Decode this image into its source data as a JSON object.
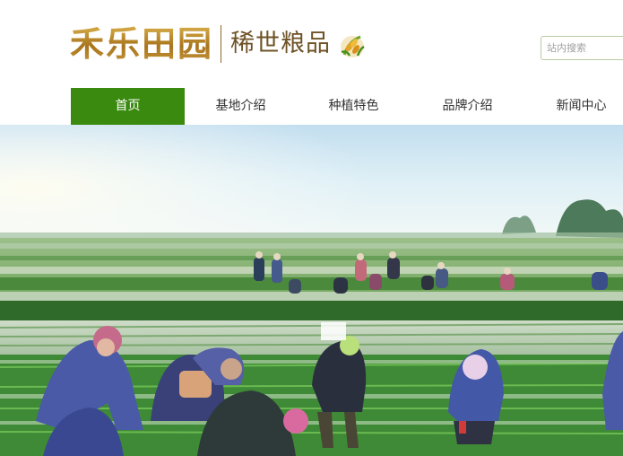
{
  "header": {
    "logo_main": "禾乐田园",
    "logo_sub": "稀世粮品",
    "search_placeholder": "站内搜索"
  },
  "nav": {
    "items": [
      {
        "label": "首页",
        "active": true
      },
      {
        "label": "基地介绍",
        "active": false
      },
      {
        "label": "种植特色",
        "active": false
      },
      {
        "label": "品牌介绍",
        "active": false
      },
      {
        "label": "新闻中心",
        "active": false
      }
    ]
  },
  "banner": {
    "image": "rice-field-planting-photo"
  },
  "colors": {
    "nav_active_bg": "#3a8a0f",
    "logo_gold": "#b8862e",
    "text": "#333333"
  }
}
